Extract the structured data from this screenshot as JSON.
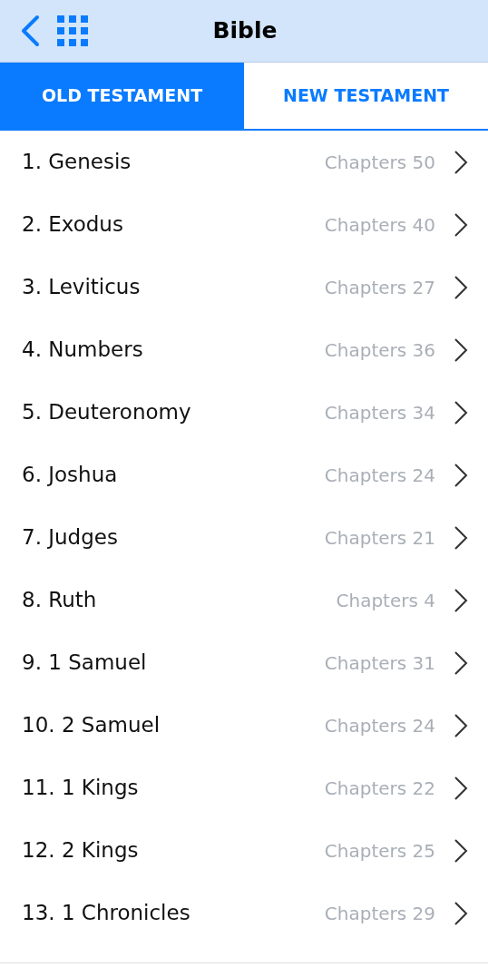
{
  "header": {
    "title": "Bible"
  },
  "tabs": [
    {
      "label": "OLD TESTAMENT",
      "selected": true
    },
    {
      "label": "NEW TESTAMENT",
      "selected": false
    }
  ],
  "books": [
    {
      "name": "1. Genesis",
      "chapters": "Chapters 50"
    },
    {
      "name": "2. Exodus",
      "chapters": "Chapters 40"
    },
    {
      "name": "3. Leviticus",
      "chapters": "Chapters 27"
    },
    {
      "name": "4. Numbers",
      "chapters": "Chapters 36"
    },
    {
      "name": "5. Deuteronomy",
      "chapters": "Chapters 34"
    },
    {
      "name": "6. Joshua",
      "chapters": "Chapters 24"
    },
    {
      "name": "7. Judges",
      "chapters": "Chapters 21"
    },
    {
      "name": "8. Ruth",
      "chapters": "Chapters 4"
    },
    {
      "name": "9. 1 Samuel",
      "chapters": "Chapters 31"
    },
    {
      "name": "10. 2 Samuel",
      "chapters": "Chapters 24"
    },
    {
      "name": "11. 1 Kings",
      "chapters": "Chapters 22"
    },
    {
      "name": "12. 2 Kings",
      "chapters": "Chapters 25"
    },
    {
      "name": "13. 1 Chronicles",
      "chapters": "Chapters 29"
    }
  ]
}
